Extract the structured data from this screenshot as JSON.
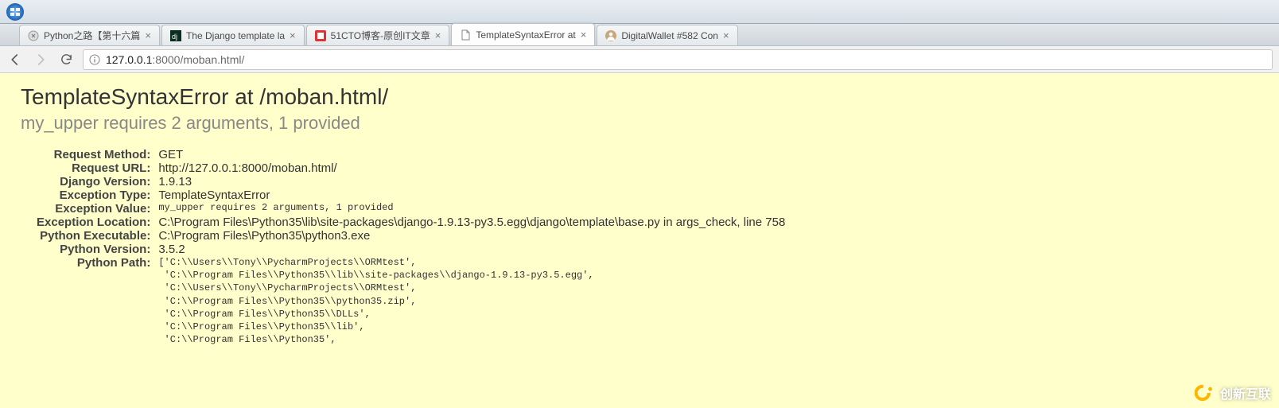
{
  "tabs": [
    {
      "title": "Python之路【第十六篇",
      "favicon": "generic"
    },
    {
      "title": "The Django template la",
      "favicon": "dj"
    },
    {
      "title": "51CTO博客-原创IT文章",
      "favicon": "51cto"
    },
    {
      "title": "TemplateSyntaxError at",
      "favicon": "page",
      "active": true
    },
    {
      "title": "DigitalWallet #582 Con",
      "favicon": "avatar"
    }
  ],
  "address": {
    "host": "127.0.0.1",
    "port": ":8000",
    "path": "/moban.html/"
  },
  "error": {
    "heading": "TemplateSyntaxError at /moban.html/",
    "subheading": "my_upper requires 2 arguments, 1 provided",
    "rows": {
      "request_method": {
        "label": "Request Method:",
        "value": "GET"
      },
      "request_url": {
        "label": "Request URL:",
        "value": "http://127.0.0.1:8000/moban.html/"
      },
      "django_version": {
        "label": "Django Version:",
        "value": "1.9.13"
      },
      "exception_type": {
        "label": "Exception Type:",
        "value": "TemplateSyntaxError"
      },
      "exception_value": {
        "label": "Exception Value:",
        "value": "my_upper requires 2 arguments, 1 provided"
      },
      "exception_location": {
        "label": "Exception Location:",
        "value": "C:\\Program Files\\Python35\\lib\\site-packages\\django-1.9.13-py3.5.egg\\django\\template\\base.py in args_check, line 758"
      },
      "python_executable": {
        "label": "Python Executable:",
        "value": "C:\\Program Files\\Python35\\python3.exe"
      },
      "python_version": {
        "label": "Python Version:",
        "value": "3.5.2"
      },
      "python_path": {
        "label": "Python Path:"
      }
    },
    "python_path_list": "['C:\\\\Users\\\\Tony\\\\PycharmProjects\\\\ORMtest',\n 'C:\\\\Program Files\\\\Python35\\\\lib\\\\site-packages\\\\django-1.9.13-py3.5.egg',\n 'C:\\\\Users\\\\Tony\\\\PycharmProjects\\\\ORMtest',\n 'C:\\\\Program Files\\\\Python35\\\\python35.zip',\n 'C:\\\\Program Files\\\\Python35\\\\DLLs',\n 'C:\\\\Program Files\\\\Python35\\\\lib',\n 'C:\\\\Program Files\\\\Python35',"
  },
  "watermark": "创新互联"
}
